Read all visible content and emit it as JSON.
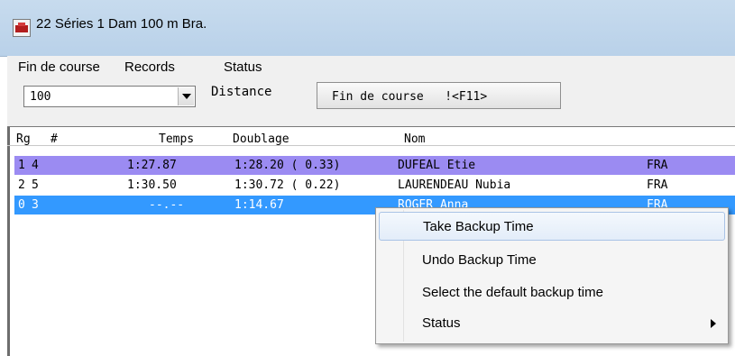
{
  "window": {
    "title": "22 Séries 1 Dam 100 m Bra."
  },
  "menu": [
    "Fin de course",
    "Records",
    "Status"
  ],
  "toolbar": {
    "distance_value": "100",
    "distance_label": "Distance",
    "fin_button": "Fin de course   !<F11>"
  },
  "table": {
    "headers": {
      "rg": "Rg",
      "num": "#",
      "temps": "Temps",
      "doublage": "Doublage",
      "nom": "Nom"
    },
    "rows": [
      {
        "rg": "1",
        "num": "4",
        "temps": "1:27.87",
        "doublage": "1:28.20 ( 0.33)",
        "nom": "DUFEAL Etie",
        "pays": "FRA"
      },
      {
        "rg": "2",
        "num": "5",
        "temps": "1:30.50",
        "doublage": "1:30.72 ( 0.22)",
        "nom": "LAURENDEAU Nubia",
        "pays": "FRA"
      },
      {
        "rg": "0",
        "num": "3",
        "temps": "--.--",
        "doublage": "1:14.67",
        "nom": "ROGER Anna",
        "pays": "FRA"
      }
    ],
    "colors": {
      "row1_bg": "#9b8bf2",
      "selected_bg": "#3399ff"
    }
  },
  "context_menu": {
    "items": [
      {
        "label": "Take Backup Time"
      },
      {
        "label": "Undo Backup Time"
      },
      {
        "label": "Select the default backup time"
      },
      {
        "label": "Status",
        "icon": "submenu-arrow-icon"
      }
    ]
  }
}
